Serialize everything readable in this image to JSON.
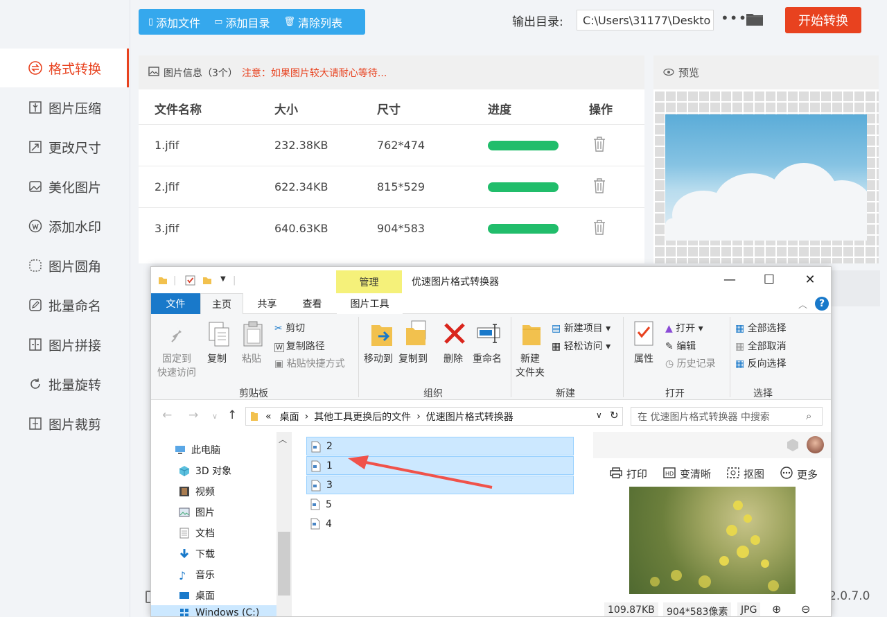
{
  "sidebar": {
    "items": [
      {
        "label": "格式转换",
        "icon": "exchange-icon"
      },
      {
        "label": "图片压缩",
        "icon": "compress-icon"
      },
      {
        "label": "更改尺寸",
        "icon": "resize-icon"
      },
      {
        "label": "美化图片",
        "icon": "beautify-icon"
      },
      {
        "label": "添加水印",
        "icon": "watermark-icon"
      },
      {
        "label": "图片圆角",
        "icon": "round-corner-icon"
      },
      {
        "label": "批量命名",
        "icon": "rename-icon"
      },
      {
        "label": "图片拼接",
        "icon": "stitch-icon"
      },
      {
        "label": "批量旋转",
        "icon": "rotate-icon"
      },
      {
        "label": "图片裁剪",
        "icon": "crop-icon"
      }
    ]
  },
  "toolbar": {
    "add_file": "添加文件",
    "add_dir": "添加目录",
    "clear_list": "清除列表",
    "output_label": "输出目录:",
    "output_path": "C:\\Users\\31177\\Deskto",
    "more": "•••",
    "start": "开始转换"
  },
  "file_panel": {
    "title": "图片信息（3个）",
    "warning": "注意：如果图片较大请耐心等待...",
    "columns": [
      "文件名称",
      "大小",
      "尺寸",
      "进度",
      "操作"
    ],
    "rows": [
      {
        "name": "1.jfif",
        "size": "232.38KB",
        "dims": "762*474",
        "progress": 1.0
      },
      {
        "name": "2.jfif",
        "size": "622.34KB",
        "dims": "815*529",
        "progress": 1.0
      },
      {
        "name": "3.jfif",
        "size": "640.63KB",
        "dims": "904*583",
        "progress": 1.0
      }
    ]
  },
  "preview": {
    "title": "预览"
  },
  "version": "2.0.7.0",
  "explorer": {
    "manage_tab": "管理",
    "title": "优速图片格式转换器",
    "tabs": [
      "文件",
      "主页",
      "共享",
      "查看",
      "图片工具"
    ],
    "ribbon": {
      "clipboard": {
        "group": "剪贴板",
        "pin": "固定到",
        "pin2": "快速访问",
        "copy": "复制",
        "paste": "粘贴",
        "cut": "剪切",
        "copy_path": "复制路径",
        "paste_shortcut": "粘贴快捷方式"
      },
      "organize": {
        "group": "组织",
        "move_to": "移动到",
        "copy_to": "复制到",
        "delete": "删除",
        "rename": "重命名"
      },
      "new": {
        "group": "新建",
        "new_folder": "新建",
        "new_folder2": "文件夹",
        "new_item": "新建项目",
        "easy_access": "轻松访问"
      },
      "open": {
        "group": "打开",
        "properties": "属性",
        "open": "打开",
        "edit": "编辑",
        "history": "历史记录"
      },
      "select": {
        "group": "选择",
        "select_all": "全部选择",
        "select_none": "全部取消",
        "invert": "反向选择"
      }
    },
    "address": {
      "prefix": "«",
      "p1": "桌面",
      "p2": "其他工具更换后的文件",
      "p3": "优速图片格式转换器",
      "search_placeholder": "在 优速图片格式转换器 中搜索"
    },
    "tree": [
      "此电脑",
      "3D 对象",
      "视频",
      "图片",
      "文档",
      "下载",
      "音乐",
      "桌面",
      "Windows (C:)"
    ],
    "files": [
      {
        "name": "2",
        "selected": true
      },
      {
        "name": "1",
        "selected": true
      },
      {
        "name": "3",
        "selected": true
      },
      {
        "name": "5",
        "selected": false
      },
      {
        "name": "4",
        "selected": false
      }
    ],
    "preview_pane": {
      "print": "打印",
      "enhance": "变清晰",
      "cutout": "抠图",
      "more": "更多",
      "size": "109.87KB",
      "dims": "904*583像素",
      "format": "JPG"
    }
  }
}
